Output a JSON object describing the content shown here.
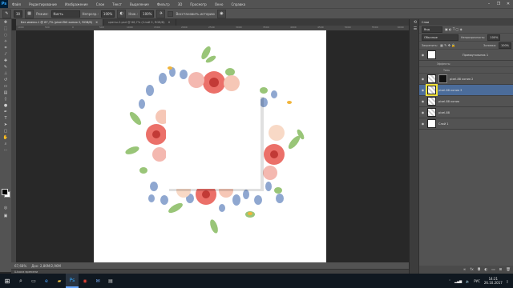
{
  "menubar": {
    "logo": "Ps",
    "items": [
      "Файл",
      "Редактирование",
      "Изображение",
      "Слои",
      "Текст",
      "Выделение",
      "Фильтр",
      "3D",
      "Просмотр",
      "Окно",
      "Справка"
    ],
    "controls": [
      "–",
      "❐",
      "✕"
    ]
  },
  "options": {
    "size": "30",
    "mode_label": "Режим:",
    "mode_value": "Кисть",
    "opacity_label": "Непрозр.:",
    "opacity_value": "100%",
    "flow_label": "Наж.:",
    "flow_value": "100%",
    "history_label": "Восстановить историю"
  },
  "tabs": [
    {
      "label": "Без имени-1 @ 67,7% (pixel-Tell копия 2, RGB/8)",
      "active": true
    },
    {
      "label": "цветы-2.psd @ 66,7% (Слой 0, RGB/8)",
      "active": false
    }
  ],
  "ruler": {
    "ticks": [
      "1000",
      "500",
      "0",
      "500",
      "1000",
      "1500",
      "2000",
      "2500",
      "3000",
      "3500",
      "4000",
      "4500",
      "5000",
      "5500",
      "6000"
    ]
  },
  "status": {
    "zoom": "67,68%",
    "doc": "Док: 2,86М/2,96М"
  },
  "timeline": {
    "label": "Шкала времени"
  },
  "panel": {
    "tab": "Слои",
    "filter_kind": "Вид",
    "blend_mode": "Обычные",
    "opacity_label": "Непрозрачность:",
    "opacity_value": "100%",
    "lock_label": "Закрепить:",
    "fill_label": "Заливка:",
    "fill_value": "100%",
    "layers": [
      {
        "name": "Прямоугольник 1",
        "selected": false,
        "thumb": "white",
        "mask": false
      },
      {
        "name": "Эффекты",
        "sub": true
      },
      {
        "name": "Тень",
        "sub": true
      },
      {
        "name": "pixel-88 копия 2",
        "selected": false,
        "thumb": "chk",
        "mask": true
      },
      {
        "name": "pixel-88 копия 3",
        "selected": true,
        "thumb": "chk",
        "mask": false
      },
      {
        "name": "pixel-88 копия",
        "selected": false,
        "thumb": "chk",
        "mask": false
      },
      {
        "name": "pixel-88",
        "selected": false,
        "thumb": "chk",
        "mask": false
      },
      {
        "name": "Слой 1",
        "selected": false,
        "thumb": "white",
        "mask": false
      }
    ]
  },
  "taskbar": {
    "time": "14:21",
    "date": "26.10.2017",
    "lang": "РУС"
  },
  "colors": {
    "ui_dark": "#535353",
    "canvas_bg": "#282828",
    "selected_layer": "#4b6c9a",
    "flower_red": "#e8574f",
    "flower_blue": "#7c98c8"
  }
}
